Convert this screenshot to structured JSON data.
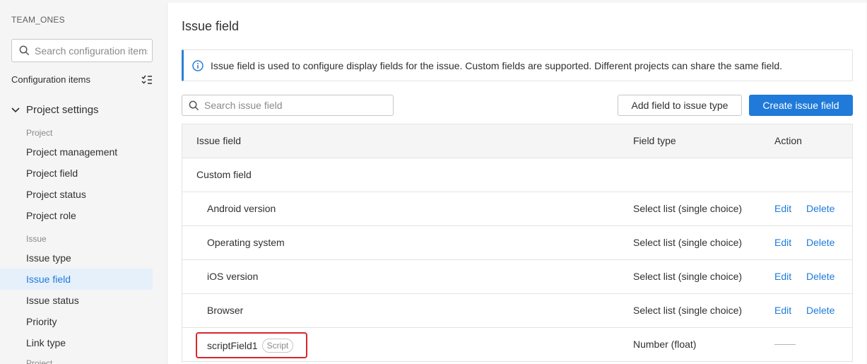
{
  "sidebar": {
    "team": "TEAM_ONES",
    "search_placeholder": "Search configuration items",
    "config_label": "Configuration items",
    "group": "Project settings",
    "sections": [
      "Project",
      "Issue",
      "Project"
    ],
    "project_items": [
      "Project management",
      "Project field",
      "Project status",
      "Project role"
    ],
    "issue_items": [
      "Issue type",
      "Issue field",
      "Issue status",
      "Priority",
      "Link type"
    ],
    "active_item": "Issue field"
  },
  "main": {
    "title": "Issue field",
    "info": "Issue field is used to configure display fields for the issue. Custom fields are supported. Different projects can share the same field.",
    "search_placeholder": "Search issue field",
    "add_button": "Add field to issue type",
    "create_button": "Create issue field"
  },
  "table": {
    "headers": [
      "Issue field",
      "Field type",
      "Action"
    ],
    "group": "Custom field",
    "rows": [
      {
        "name": "Android version",
        "type": "Select list (single choice)",
        "edit": "Edit",
        "delete": "Delete"
      },
      {
        "name": "Operating system",
        "type": "Select list (single choice)",
        "edit": "Edit",
        "delete": "Delete"
      },
      {
        "name": "iOS version",
        "type": "Select list (single choice)",
        "edit": "Edit",
        "delete": "Delete"
      },
      {
        "name": "Browser",
        "type": "Select list (single choice)",
        "edit": "Edit",
        "delete": "Delete"
      }
    ],
    "script_row": {
      "name": "scriptField1",
      "badge": "Script",
      "type": "Number (float)"
    }
  },
  "colors": {
    "accent": "#1f7ad9",
    "highlight": "#d9262c"
  }
}
